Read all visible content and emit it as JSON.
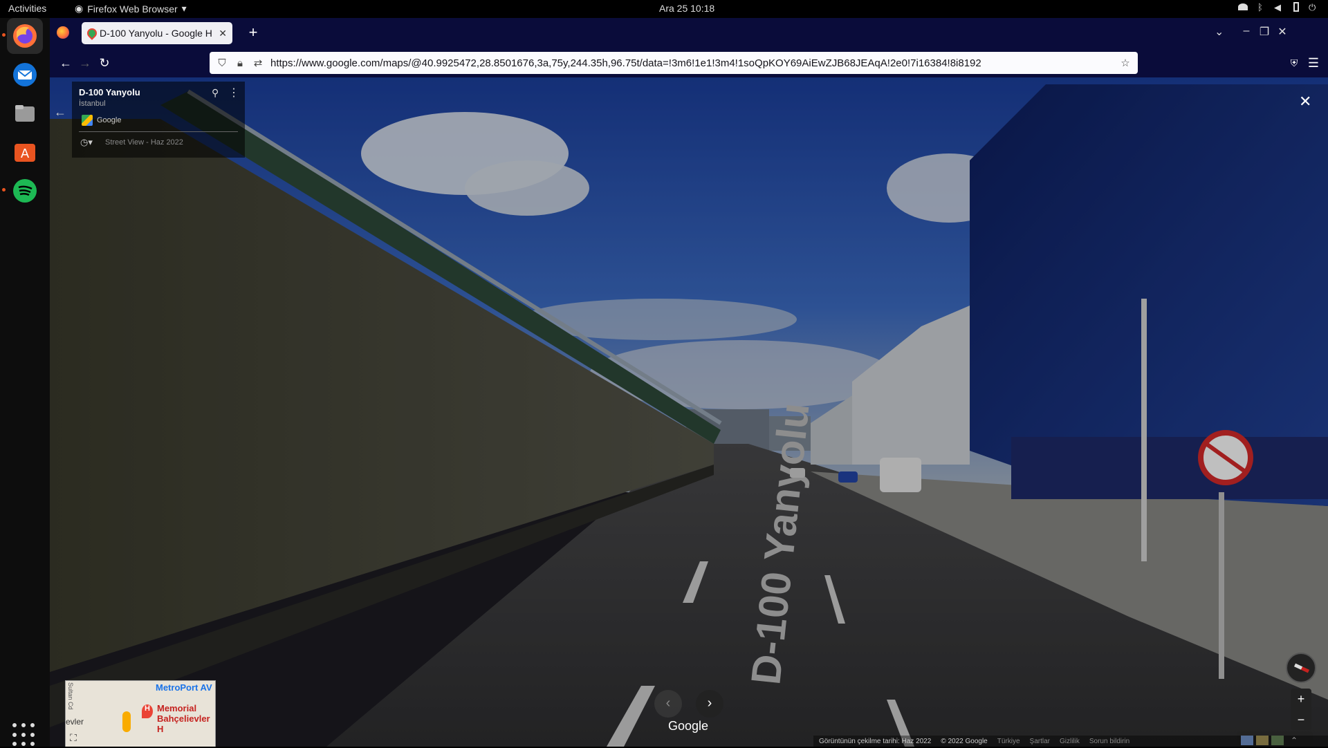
{
  "topbar": {
    "activities": "Activities",
    "app_name": "Firefox Web Browser",
    "clock": "Ara 25  10:18"
  },
  "dock": {
    "items": [
      "firefox-icon",
      "thunderbird-icon",
      "files-icon",
      "app-center-icon",
      "spotify-icon"
    ]
  },
  "browser": {
    "tab_title": "D-100 Yanyolu - Google H",
    "url": "https://www.google.com/maps/@40.9925472,28.8501676,3a,75y,244.35h,96.75t/data=!3m6!1e1!3m4!1soQpKOY69AiEwZJB68JEAqA!2e0!7i16384!8i8192"
  },
  "streetview": {
    "place_name": "D-100 Yanyolu",
    "city": "İstanbul",
    "source": "Google",
    "capture": "Street View - Haz 2022",
    "road_marking": "D-100 Yanyolu",
    "google_logo": "Google"
  },
  "minimap": {
    "label_metroport": "MetroPort AV",
    "label_hospital": "Memorial Bahçelievler H",
    "label_evler": "evler",
    "label_street": "Sultan Cd"
  },
  "footer": {
    "capture_date": "Görüntünün çekilme tarihi: Haz 2022",
    "copyright": "© 2022 Google",
    "region": "Türkiye",
    "terms": "Şartlar",
    "privacy": "Gizlilik",
    "report": "Sorun bildirin"
  },
  "colors": {
    "tabbar_bg": "#0a0c3a",
    "accent_orange": "#e95420",
    "sky_blue": "#2c56b8"
  }
}
